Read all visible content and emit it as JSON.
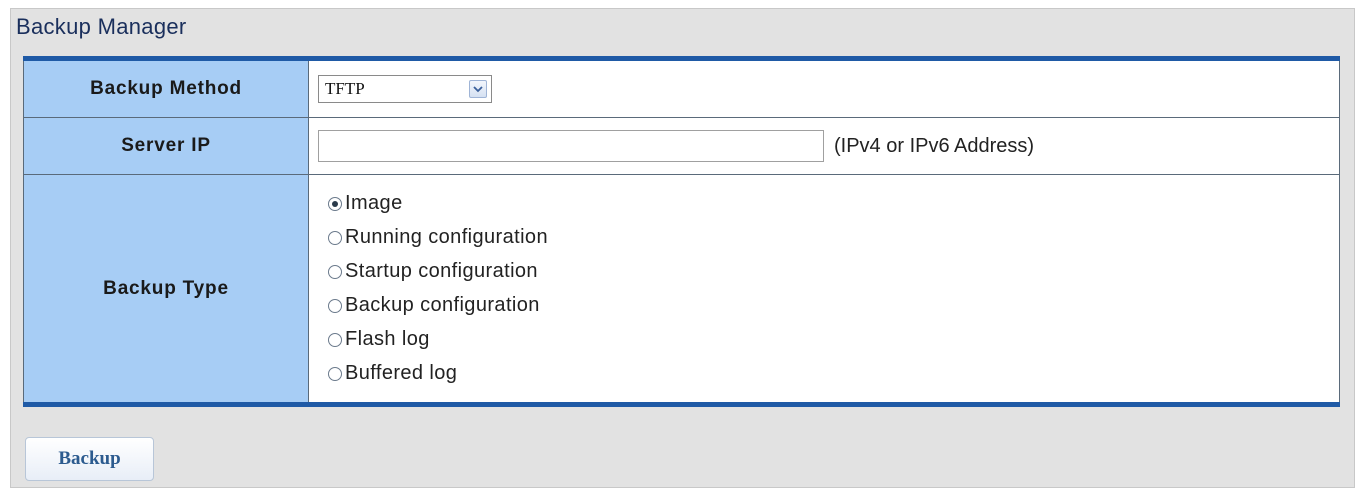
{
  "page": {
    "title": "Backup Manager"
  },
  "form": {
    "backup_method": {
      "label": "Backup Method",
      "selected": "TFTP"
    },
    "server_ip": {
      "label": "Server IP",
      "value": "",
      "hint": "(IPv4 or IPv6 Address)"
    },
    "backup_type": {
      "label": "Backup Type",
      "options": [
        {
          "label": "Image",
          "checked": true
        },
        {
          "label": "Running configuration",
          "checked": false
        },
        {
          "label": "Startup configuration",
          "checked": false
        },
        {
          "label": "Backup configuration",
          "checked": false
        },
        {
          "label": "Flash log",
          "checked": false
        },
        {
          "label": "Buffered log",
          "checked": false
        }
      ]
    }
  },
  "actions": {
    "backup_label": "Backup"
  },
  "colors": {
    "header_border": "#1f5aa6",
    "label_cell_bg": "#a7cdf5",
    "panel_bg": "#e2e2e2",
    "title_text": "#1a2f5c",
    "button_text": "#2c5b8f"
  },
  "icons": {
    "select_arrow": "chevron-down-icon",
    "radio_checked": "radio-checked-icon",
    "radio_unchecked": "radio-unchecked-icon"
  }
}
